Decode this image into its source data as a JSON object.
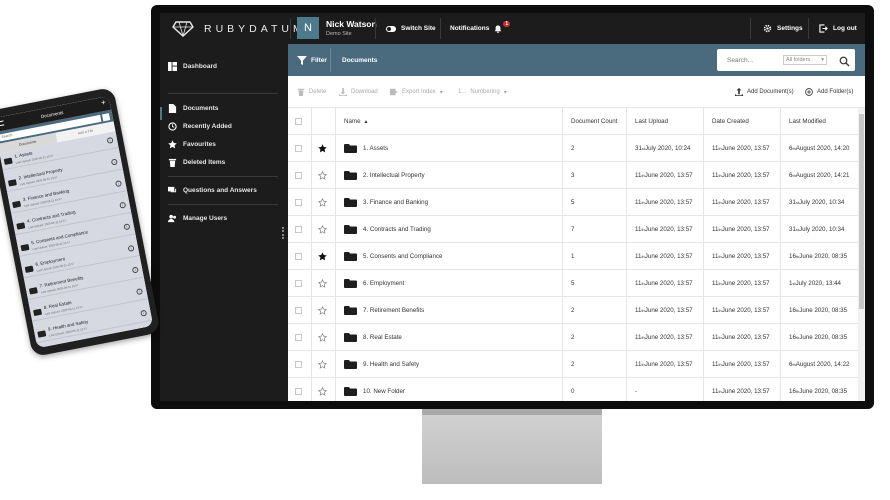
{
  "app": {
    "brand": "RUBYDATUM",
    "user": {
      "initial": "N",
      "name": "Nick Watson",
      "site": "Demo Site"
    },
    "switch_site": "Switch Site",
    "notifications": "Notifications",
    "notification_count": "1",
    "settings": "Settings",
    "logout": "Log out"
  },
  "sidebar": {
    "items": [
      {
        "label": "Dashboard",
        "icon": "dashboard-icon"
      },
      {
        "label": "Documents",
        "icon": "document-icon"
      },
      {
        "label": "Recently Added",
        "icon": "history-icon"
      },
      {
        "label": "Favourites",
        "icon": "star-icon"
      },
      {
        "label": "Deleted Items",
        "icon": "trash-icon"
      },
      {
        "label": "Questions and Answers",
        "icon": "chat-icon"
      },
      {
        "label": "Manage Users",
        "icon": "users-icon"
      }
    ]
  },
  "filterbar": {
    "filter": "Filter",
    "title": "Documents",
    "search_placeholder": "Search...",
    "folder_scope": "All folders"
  },
  "toolbar": {
    "delete": "Delete",
    "download": "Download",
    "export_index": "Export Index",
    "numbering_prefix": "1...",
    "numbering": "Numbering",
    "add_document": "Add Document(s)",
    "add_folder": "Add Folder(s)"
  },
  "table": {
    "headers": {
      "name": "Name",
      "count": "Document Count",
      "upload": "Last Upload",
      "created": "Date Created",
      "modified": "Last Modified"
    },
    "rows": [
      {
        "name": "1. Assets",
        "starred": true,
        "count": "2",
        "up_d": "31",
        "up_s": "st",
        "up_r": " July 2020, 10:24",
        "cr_d": "11",
        "cr_s": "th",
        "cr_r": " June 2020, 13:57",
        "mo_d": "6",
        "mo_s": "th",
        "mo_r": " August 2020, 14:20"
      },
      {
        "name": "2. Intellectual Property",
        "starred": false,
        "count": "3",
        "up_d": "11",
        "up_s": "th",
        "up_r": " June 2020, 13:57",
        "cr_d": "11",
        "cr_s": "th",
        "cr_r": " June 2020, 13:57",
        "mo_d": "6",
        "mo_s": "th",
        "mo_r": " August 2020, 14:21"
      },
      {
        "name": "3. Finance and Banking",
        "starred": false,
        "count": "5",
        "up_d": "11",
        "up_s": "th",
        "up_r": " June 2020, 13:57",
        "cr_d": "11",
        "cr_s": "th",
        "cr_r": " June 2020, 13:57",
        "mo_d": "31",
        "mo_s": "st",
        "mo_r": " July 2020, 10:34"
      },
      {
        "name": "4. Contracts and Trading",
        "starred": false,
        "count": "7",
        "up_d": "11",
        "up_s": "th",
        "up_r": " June 2020, 13:57",
        "cr_d": "11",
        "cr_s": "th",
        "cr_r": " June 2020, 13:57",
        "mo_d": "31",
        "mo_s": "st",
        "mo_r": " July 2020, 10:34"
      },
      {
        "name": "5. Consents and Compliance",
        "starred": true,
        "count": "1",
        "up_d": "11",
        "up_s": "th",
        "up_r": " June 2020, 13:57",
        "cr_d": "11",
        "cr_s": "th",
        "cr_r": " June 2020, 13:57",
        "mo_d": "16",
        "mo_s": "th",
        "mo_r": " June 2020, 08:35"
      },
      {
        "name": "6. Employment",
        "starred": false,
        "count": "5",
        "up_d": "11",
        "up_s": "th",
        "up_r": " June 2020, 13:57",
        "cr_d": "11",
        "cr_s": "th",
        "cr_r": " June 2020, 13:57",
        "mo_d": "1",
        "mo_s": "st",
        "mo_r": " July 2020, 13:44"
      },
      {
        "name": "7. Retirement Benefits",
        "starred": false,
        "count": "2",
        "up_d": "11",
        "up_s": "th",
        "up_r": " June 2020, 13:57",
        "cr_d": "11",
        "cr_s": "th",
        "cr_r": " June 2020, 13:57",
        "mo_d": "16",
        "mo_s": "th",
        "mo_r": " June 2020, 08:35"
      },
      {
        "name": "8. Real Estate",
        "starred": false,
        "count": "2",
        "up_d": "11",
        "up_s": "th",
        "up_r": " June 2020, 13:57",
        "cr_d": "11",
        "cr_s": "th",
        "cr_r": " June 2020, 13:57",
        "mo_d": "16",
        "mo_s": "th",
        "mo_r": " June 2020, 08:35"
      },
      {
        "name": "9. Health and Safety",
        "starred": false,
        "count": "2",
        "up_d": "11",
        "up_s": "th",
        "up_r": " June 2020, 13:57",
        "cr_d": "11",
        "cr_s": "th",
        "cr_r": " June 2020, 13:57",
        "mo_d": "6",
        "mo_s": "th",
        "mo_r": " August 2020, 14:22"
      },
      {
        "name": "10. New Folder",
        "starred": false,
        "count": "0",
        "up_d": "-",
        "up_s": "",
        "up_r": "",
        "cr_d": "11",
        "cr_s": "th",
        "cr_r": " June 2020, 13:57",
        "mo_d": "16",
        "mo_s": "th",
        "mo_r": " June 2020, 08:35"
      }
    ]
  },
  "phone": {
    "title": "Documents",
    "search_placeholder": "Search",
    "tabs": [
      "Documents",
      "Add a File"
    ],
    "items": [
      {
        "name": "1. Assets",
        "sub": "Last Upload: 2020-06-11 13:57"
      },
      {
        "name": "2. Intellectual Property",
        "sub": "Last Upload: 2020-06-11 13:57"
      },
      {
        "name": "3. Finance and Banking",
        "sub": "Last Upload: 2020-06-11 13:57"
      },
      {
        "name": "4. Contracts and Trading",
        "sub": "Last Upload: 2020-06-11 13:57"
      },
      {
        "name": "5. Consents and Compliance",
        "sub": "Last Upload: 2020-06-11 13:57"
      },
      {
        "name": "6. Employment",
        "sub": "Last Upload: 2020-06-11 13:57"
      },
      {
        "name": "7. Retirement Benefits",
        "sub": "Last Upload: 2020-06-11 13:57"
      },
      {
        "name": "8. Real Estate",
        "sub": "Last Upload: 2020-06-11 13:57"
      },
      {
        "name": "9. Health and Safety",
        "sub": "Last Upload: 2020-06-11 13:57"
      }
    ]
  },
  "colors": {
    "accent": "#4a6a7e",
    "topbar": "#1c1c1c",
    "badge": "#d0292c"
  }
}
